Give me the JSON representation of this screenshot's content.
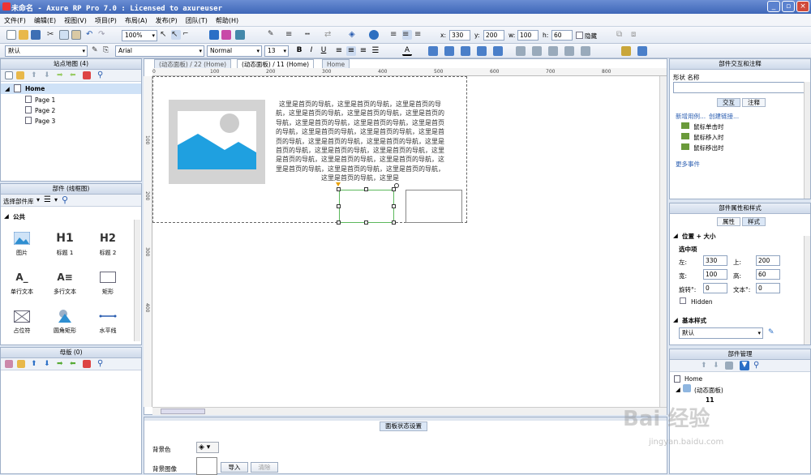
{
  "window": {
    "title": "未命名 - Axure RP Pro 7.0 : Licensed to axureuser"
  },
  "menu": [
    "文件(F)",
    "编辑(E)",
    "视图(V)",
    "项目(P)",
    "布局(A)",
    "发布(P)",
    "团队(T)",
    "帮助(H)"
  ],
  "toolbar1": {
    "zoom": "100%",
    "x_label": "x:",
    "x": "330",
    "y_label": "y:",
    "y": "200",
    "w_label": "w:",
    "w": "100",
    "h_label": "h:",
    "h": "60",
    "hidden_label": "隐藏"
  },
  "toolbar2": {
    "style": "默认",
    "font": "Arial",
    "weight": "Normal",
    "size": "13",
    "bold": "B",
    "italic": "I",
    "underline": "U",
    "font_color": "A"
  },
  "sitemap": {
    "title": "站点地图 (4)",
    "root": "Home",
    "pages": [
      "Page 1",
      "Page 2",
      "Page 3"
    ]
  },
  "widgets": {
    "title": "部件 (线框图)",
    "library": "选择部件库",
    "group": "公共",
    "items": [
      {
        "label": "图片",
        "glyph": "image-icon"
      },
      {
        "label": "标题 1",
        "glyph": "H1"
      },
      {
        "label": "标题 2",
        "glyph": "H2"
      },
      {
        "label": "单行文本",
        "glyph": "A_"
      },
      {
        "label": "多行文本",
        "glyph": "A≡"
      },
      {
        "label": "矩形",
        "glyph": "rect-icon"
      },
      {
        "label": "占位符",
        "glyph": "placeholder-icon"
      },
      {
        "label": "圆角矩形",
        "glyph": "shape-icon"
      },
      {
        "label": "水平线",
        "glyph": "line-icon"
      }
    ]
  },
  "masters": {
    "title": "母版 (0)"
  },
  "tabs": [
    "(动态面板) / 22 (Home)",
    "(动态面板) / 11 (Home)",
    "Home"
  ],
  "ruler_h": [
    "0",
    "100",
    "200",
    "300",
    "400",
    "500",
    "600",
    "700",
    "800"
  ],
  "ruler_v": [
    "100",
    "200",
    "300",
    "400"
  ],
  "canvas": {
    "text": "这里是首页的导航，这里是首页的导航，这里是首页的导航，这里是首页的导航，这里是首页的导航，这里是首页的导航，这里是首页的导航，这里是首页的导航，这里是首页的导航，这里是首页的导航，这里是首页的导航，这里是首页的导航，这里是首页的导航，这里是首页的导航，这里是首页的导航，这里是首页的导航，这里是首页的导航，这里是首页的导航，这里是首页的导航，这里是首页的导航，这里是首页的导航，这里是首页的导航，这里是首页的导航，这里是首页的导航，这里是"
  },
  "bottom": {
    "tab": "面板状态设置",
    "bg_color": "背景色",
    "bg_image": "背景图像",
    "import": "导入",
    "clear": "清除"
  },
  "interaction": {
    "title": "部件交互和注释",
    "shape_name": "形状  名称",
    "tab_interact": "交互",
    "tab_note": "注释",
    "new_case": "新增用例...",
    "create_link": "创建链接...",
    "events": [
      "鼠标单击时",
      "鼠标移入时",
      "鼠标移出时"
    ],
    "more": "更多事件"
  },
  "props": {
    "title": "部件属性和样式",
    "tab_props": "属性",
    "tab_style": "样式",
    "section": "位置 + 大小",
    "selected": "选中项",
    "left_label": "左:",
    "left": "330",
    "top_label": "上:",
    "top": "200",
    "width_label": "宽:",
    "width": "100",
    "height_label": "高:",
    "height": "60",
    "rotate_label": "旋转°:",
    "rotate": "0",
    "text_label": "文本°:",
    "text_rot": "0",
    "hidden": "Hidden",
    "base_style": "基本样式",
    "style_value": "默认"
  },
  "manager": {
    "title": "部件管理",
    "root": "Home",
    "panel": "(动态面板)",
    "state": "11"
  },
  "watermark": {
    "text": "Bai 经验",
    "sub": "jingyan.baidu.com"
  }
}
